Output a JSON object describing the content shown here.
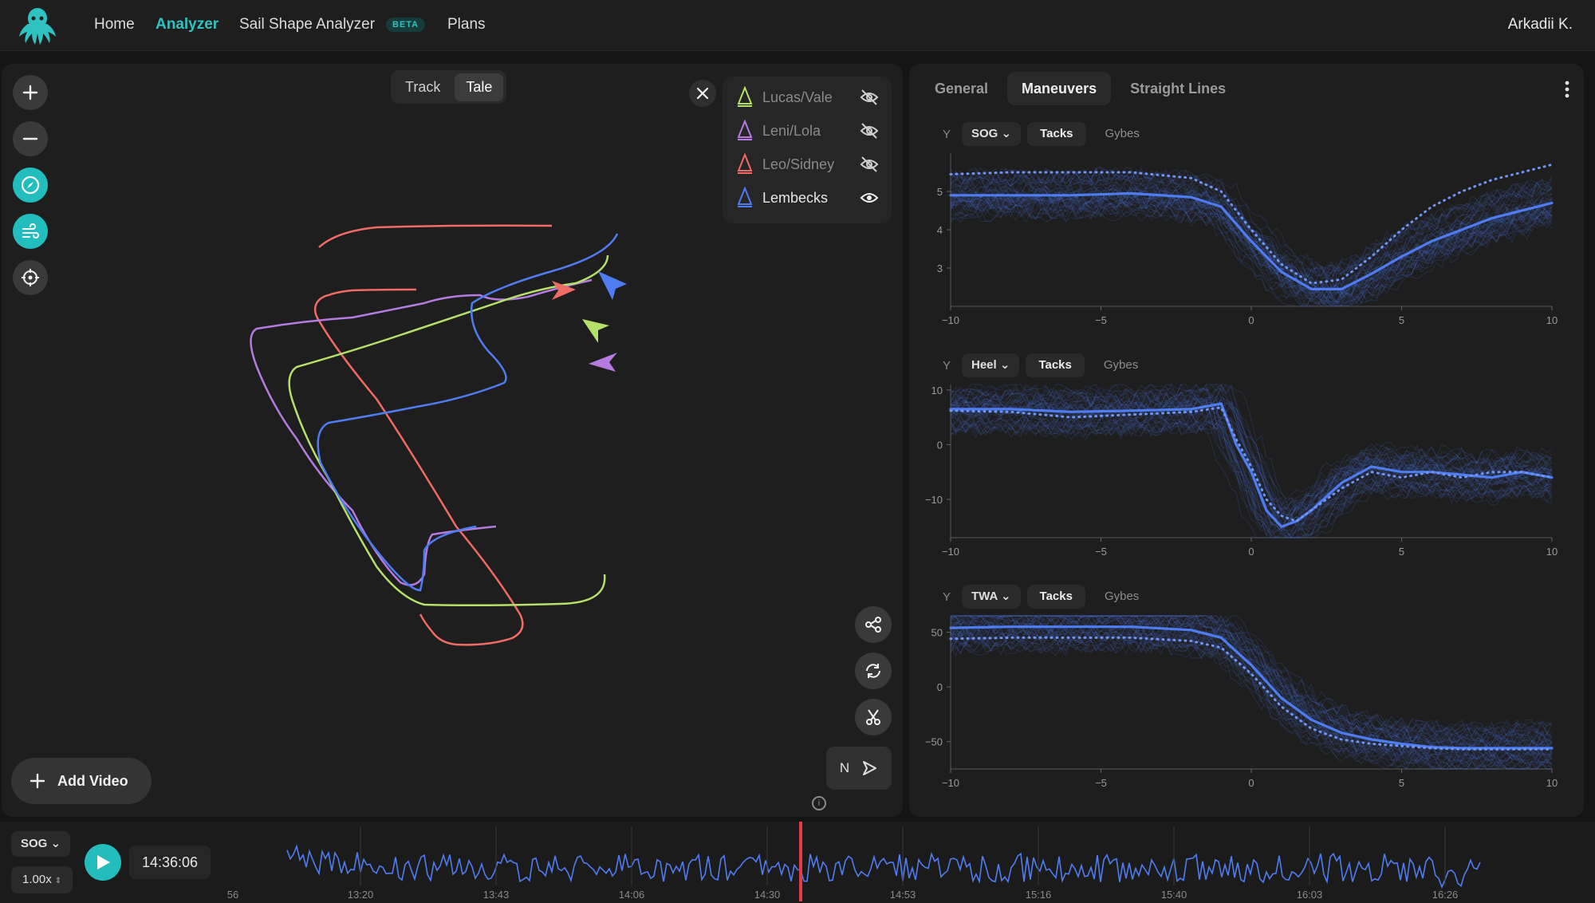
{
  "nav": {
    "home": "Home",
    "analyzer": "Analyzer",
    "sail_shape": "Sail Shape Analyzer",
    "beta": "BETA",
    "plans": "Plans",
    "user": "Arkadii K."
  },
  "map": {
    "view_toggle": [
      "Track",
      "Tale"
    ],
    "active_view": "Tale",
    "boats": [
      {
        "name": "Lucas/Vale",
        "color": "#b5e06a",
        "visible": false
      },
      {
        "name": "Leni/Lola",
        "color": "#b57be0",
        "visible": false
      },
      {
        "name": "Leo/Sidney",
        "color": "#f06b64",
        "visible": false
      },
      {
        "name": "Lembecks",
        "color": "#4f7cf0",
        "visible": true
      }
    ],
    "north_label": "N",
    "add_video": "Add Video"
  },
  "analysis": {
    "tabs": [
      "General",
      "Maneuvers",
      "Straight Lines"
    ],
    "active_tab": "Maneuvers",
    "y_label": "Y",
    "filter_options": [
      "Tacks",
      "Gybes"
    ],
    "active_filter": "Tacks"
  },
  "chart_data": [
    {
      "type": "line",
      "metric": "SOG",
      "x_ticks": [
        -10,
        -5,
        0,
        5,
        10
      ],
      "y_ticks": [
        3,
        4,
        5
      ],
      "xlim": [
        -10,
        10
      ],
      "ylim": [
        2.0,
        6.0
      ],
      "x": [
        -10,
        -8,
        -6,
        -4,
        -2,
        -1,
        0,
        1,
        2,
        3,
        4,
        5,
        6,
        7,
        8,
        9,
        10
      ],
      "series": [
        {
          "style": "solid",
          "values": [
            4.9,
            4.9,
            4.9,
            4.95,
            4.85,
            4.6,
            3.7,
            2.9,
            2.45,
            2.45,
            2.85,
            3.3,
            3.7,
            4.0,
            4.3,
            4.5,
            4.7
          ]
        },
        {
          "style": "dotted",
          "values": [
            5.45,
            5.5,
            5.5,
            5.5,
            5.35,
            5.0,
            4.0,
            3.1,
            2.6,
            2.7,
            3.3,
            4.0,
            4.6,
            5.0,
            5.3,
            5.5,
            5.7
          ]
        }
      ]
    },
    {
      "type": "line",
      "metric": "Heel",
      "x_ticks": [
        -10,
        -5,
        0,
        5,
        10
      ],
      "y_ticks": [
        -10,
        0,
        10
      ],
      "xlim": [
        -10,
        10
      ],
      "ylim": [
        -17,
        11
      ],
      "x": [
        -10,
        -8,
        -6,
        -4,
        -2,
        -1,
        -0.5,
        0,
        0.5,
        1,
        1.5,
        2,
        3,
        4,
        5,
        6,
        7,
        8,
        9,
        10
      ],
      "series": [
        {
          "style": "solid",
          "values": [
            6.5,
            6.5,
            6.0,
            6.2,
            6.5,
            7.5,
            0,
            -5,
            -12,
            -15,
            -14,
            -12,
            -7,
            -4,
            -5,
            -5,
            -5.5,
            -6,
            -5,
            -6
          ]
        },
        {
          "style": "dotted",
          "values": [
            6.2,
            6.0,
            5.0,
            5.5,
            6.0,
            6.8,
            1,
            -4,
            -10,
            -13,
            -14,
            -12,
            -8,
            -5,
            -6,
            -5,
            -6,
            -5,
            -5,
            -6
          ]
        }
      ]
    },
    {
      "type": "line",
      "metric": "TWA",
      "x_ticks": [
        -10,
        -5,
        0,
        5,
        10
      ],
      "y_ticks": [
        -50,
        0,
        50
      ],
      "xlim": [
        -10,
        10
      ],
      "ylim": [
        -75,
        65
      ],
      "x": [
        -10,
        -8,
        -6,
        -4,
        -2,
        -1,
        0,
        1,
        2,
        3,
        4,
        5,
        6,
        7,
        8,
        9,
        10
      ],
      "series": [
        {
          "style": "solid",
          "values": [
            54,
            55,
            55,
            55,
            52,
            45,
            20,
            -10,
            -30,
            -42,
            -48,
            -52,
            -55,
            -56,
            -56,
            -56,
            -56
          ]
        },
        {
          "style": "dotted",
          "values": [
            44,
            45,
            45,
            45,
            42,
            36,
            12,
            -18,
            -38,
            -48,
            -52,
            -54,
            -56,
            -57,
            -57,
            -57,
            -57
          ]
        }
      ]
    }
  ],
  "timeline": {
    "metric": "SOG",
    "speed": "1.00x",
    "current_time": "14:36:06",
    "tick_labels": [
      "56",
      "13:20",
      "13:43",
      "14:06",
      "14:30",
      "14:53",
      "15:16",
      "15:40",
      "16:03",
      "16:26"
    ]
  },
  "colors": {
    "accent": "#23bdbd",
    "series": "#4f7cf0",
    "playhead": "#e23b4a"
  }
}
